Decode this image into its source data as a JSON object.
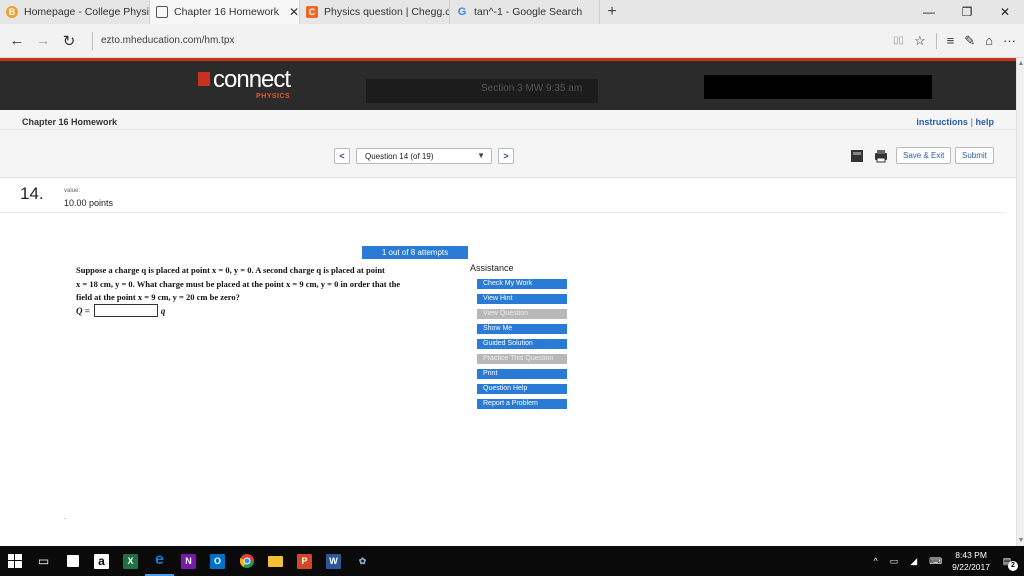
{
  "browser": {
    "tabs": [
      {
        "icon": "B",
        "icon_color": "#f0a030",
        "label": "Homepage - College Physic"
      },
      {
        "icon": "▭",
        "icon_color": "#555555",
        "label": "Chapter 16 Homework",
        "close": "✕"
      },
      {
        "icon": "C",
        "icon_color": "#f26522",
        "label": "Physics question | Chegg.cc"
      },
      {
        "icon": "G",
        "icon_color": "#4285f4",
        "label": "tan^-1 - Google Search"
      }
    ],
    "new_tab": "+",
    "window_controls": {
      "minimize": "—",
      "restore": "❐",
      "close": "✕"
    },
    "back": "←",
    "forward": "→",
    "refresh": "↻",
    "url": "ezto.mheducation.com/hm.tpx",
    "toolbar_icons": {
      "reading": "▯▯",
      "favorite": "☆",
      "hub": "≡",
      "notes": "✎",
      "share": "⌂",
      "more": "···"
    }
  },
  "header": {
    "logo_word": "connect",
    "logo_sub": "PHYSICS",
    "redacted_text": "Section 3 MW 9:35 am"
  },
  "assignment": {
    "title": "Chapter 16 Homework",
    "instructions": "instructions",
    "help": "help",
    "help_sep": "|"
  },
  "question_nav": {
    "prev": "<",
    "next": ">",
    "selected": "Question 14 (of 19)",
    "caret": "▼",
    "save_exit": "Save & Exit",
    "submit": "Submit"
  },
  "question": {
    "number": "14.",
    "value_label": "value:",
    "points": "10.00 points",
    "attempts": "1 out of 8 attempts",
    "text_line1": "Suppose a charge q is placed at point x = 0, y = 0. A second charge q is placed at point",
    "text_line2": "x = 18 cm, y = 0. What charge must be placed at the point x = 9 cm, y = 0 in order that the",
    "text_line3": "field at the point x = 9 cm, y = 20 cm be zero?",
    "answer_prefix": "Q =",
    "answer_value": "",
    "answer_suffix": "q"
  },
  "assistance": {
    "title": "Assistance",
    "buttons": [
      {
        "label": "Check My Work",
        "enabled": true
      },
      {
        "label": "View Hint",
        "enabled": true
      },
      {
        "label": "View Question",
        "enabled": false
      },
      {
        "label": "Show Me",
        "enabled": true
      },
      {
        "label": "Guided Solution",
        "enabled": true
      },
      {
        "label": "Practice This Question",
        "enabled": false
      },
      {
        "label": "Print",
        "enabled": true
      },
      {
        "label": "Question Help",
        "enabled": true
      },
      {
        "label": "Report a Problem",
        "enabled": true
      }
    ]
  },
  "taskbar": {
    "time": "8:43 PM",
    "date": "9/22/2017",
    "notification_count": "2",
    "apps": [
      {
        "name": "start",
        "glyph": "⊞",
        "color": "#0a0a0a"
      },
      {
        "name": "task-view",
        "glyph": "▭",
        "color": "#0a0a0a"
      },
      {
        "name": "store",
        "glyph": "🛍",
        "color": "#0a0a0a"
      },
      {
        "name": "amazon",
        "glyph": "a",
        "color": "#ffffff"
      },
      {
        "name": "excel",
        "glyph": "X",
        "color": "#1e7145"
      },
      {
        "name": "edge",
        "glyph": "e",
        "color": "#1e78d6"
      },
      {
        "name": "onenote",
        "glyph": "N",
        "color": "#7719aa"
      },
      {
        "name": "outlook",
        "glyph": "O",
        "color": "#0072c6"
      },
      {
        "name": "chrome",
        "glyph": "●",
        "color": "#0a0a0a"
      },
      {
        "name": "file-explorer",
        "glyph": "▬",
        "color": "#f3c136"
      },
      {
        "name": "powerpoint",
        "glyph": "P",
        "color": "#d24726"
      },
      {
        "name": "word",
        "glyph": "W",
        "color": "#2b579a"
      },
      {
        "name": "other-app",
        "glyph": "✿",
        "color": "#0a0a0a"
      }
    ]
  }
}
